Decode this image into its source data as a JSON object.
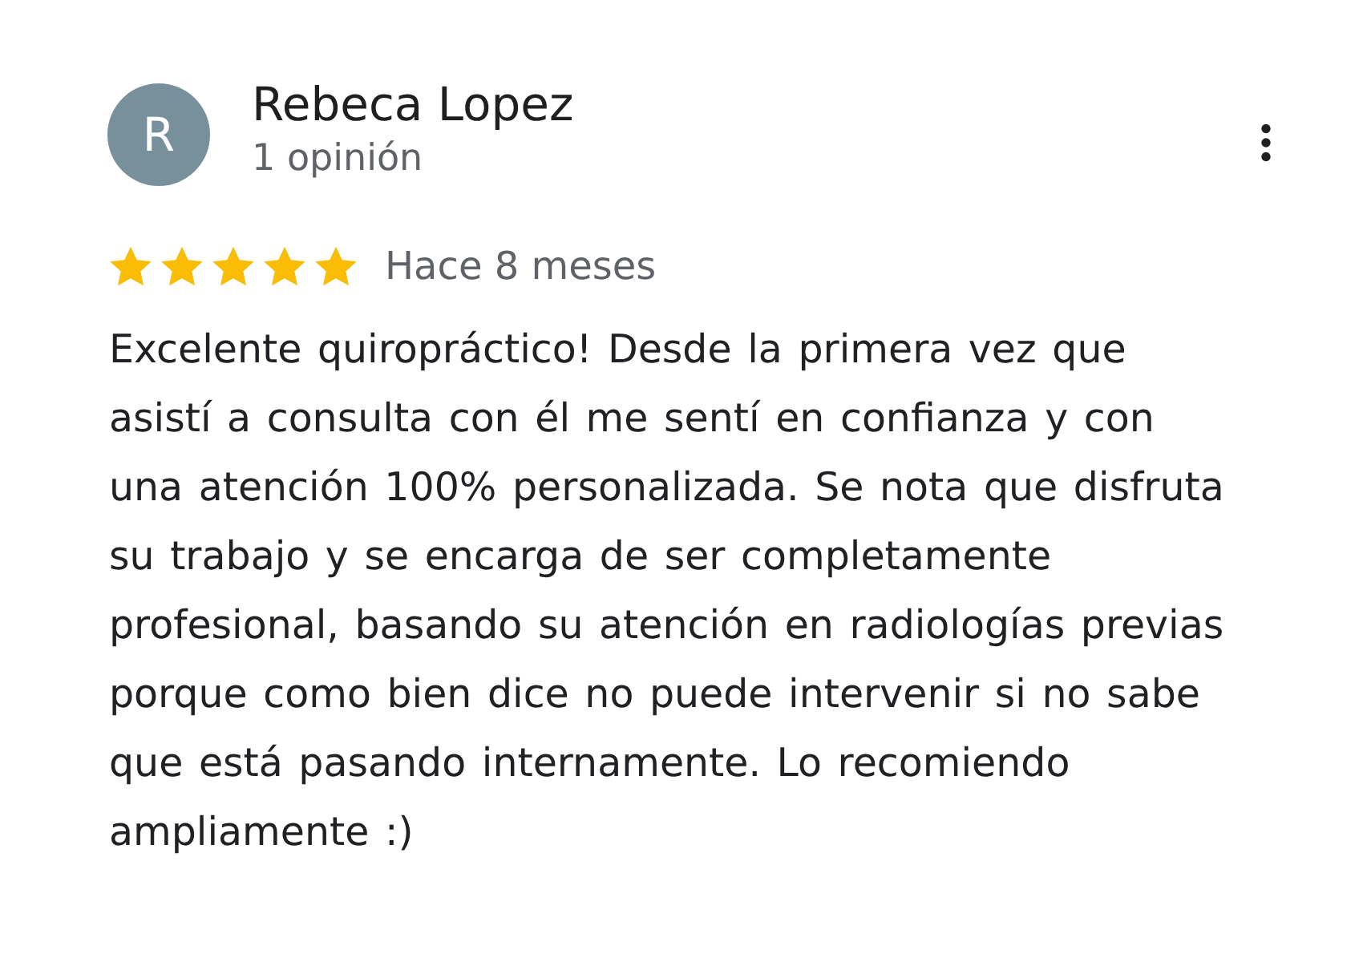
{
  "review": {
    "avatar_letter": "R",
    "author": "Rebeca Lopez",
    "review_count": "1 opinión",
    "stars": 5,
    "time": "Hace 8 meses",
    "text": "Excelente quiropráctico! Desde la primera vez que asistí a consulta con él me sentí en confianza y con una atención 100% personalizada. Se nota que disfruta su trabajo y se encarga de ser completamente profesional, basando su atención en radiologías previas porque como bien dice no puede intervenir si no sabe que está pasando internamente. Lo recomiendo ampliamente :)"
  }
}
